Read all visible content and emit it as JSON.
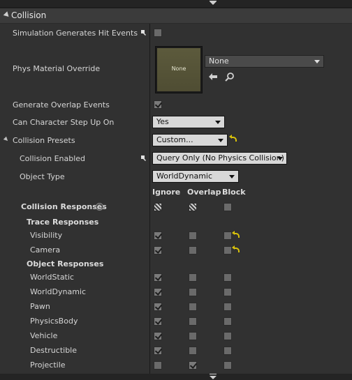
{
  "section": {
    "title": "Collision"
  },
  "props": {
    "simulation_hit_events": "Simulation Generates Hit Events",
    "phys_material_override": "Phys Material Override",
    "phys_material_thumb": "None",
    "phys_material_value": "None",
    "generate_overlap_events": "Generate Overlap Events",
    "can_character_step_up_on": "Can Character Step Up On",
    "can_character_step_up_on_value": "Yes",
    "collision_presets": "Collision Presets",
    "collision_presets_value": "Custom...",
    "collision_enabled": "Collision Enabled",
    "collision_enabled_value": "Query Only (No Physics Collision)",
    "object_type": "Object Type",
    "object_type_value": "WorldDynamic"
  },
  "response_headers": [
    "Ignore",
    "Overlap",
    "Block"
  ],
  "collision_responses": {
    "title": "Collision Responses",
    "help": "?",
    "trace_responses_title": "Trace Responses",
    "object_responses_title": "Object Responses"
  },
  "trace_rows": [
    {
      "label": "Visibility",
      "state": "ignore"
    },
    {
      "label": "Camera",
      "state": "ignore"
    }
  ],
  "object_rows": [
    {
      "label": "WorldStatic",
      "state": "ignore"
    },
    {
      "label": "WorldDynamic",
      "state": "ignore"
    },
    {
      "label": "Pawn",
      "state": "ignore"
    },
    {
      "label": "PhysicsBody",
      "state": "ignore"
    },
    {
      "label": "Vehicle",
      "state": "ignore"
    },
    {
      "label": "Destructible",
      "state": "ignore"
    },
    {
      "label": "Projectile",
      "state": "overlap"
    }
  ],
  "checkbox_states": {
    "simulation_hit_events": false,
    "generate_overlap_events": true,
    "collision_responses_all": "mixed"
  }
}
